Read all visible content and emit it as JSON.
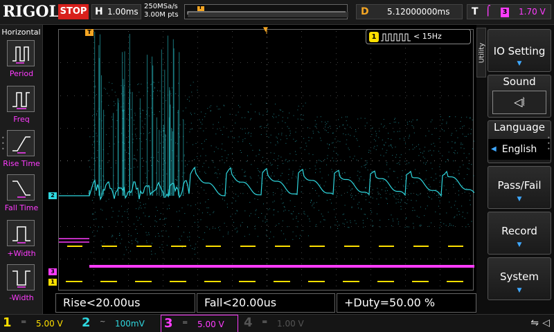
{
  "topbar": {
    "brand": "RIGOL",
    "run_state": "STOP",
    "horizontal_letter": "H",
    "timebase": "1.00ms",
    "sample_rate": "250MSa/s",
    "memory_depth": "3.00M pts",
    "trigger_marker": "T",
    "delay_letter": "D",
    "delay_value": "5.12000000ms",
    "trigger_letter": "T",
    "trigger_source": "3",
    "trigger_level": "1.70 V"
  },
  "left_panel": {
    "title": "Horizontal",
    "items": [
      {
        "label": "Period",
        "icon": "period-icon"
      },
      {
        "label": "Freq",
        "icon": "freq-icon"
      },
      {
        "label": "Rise Time",
        "icon": "rise-time-icon"
      },
      {
        "label": "Fall Time",
        "icon": "fall-time-icon"
      },
      {
        "label": "+Width",
        "icon": "positive-width-icon"
      },
      {
        "label": "-Width",
        "icon": "negative-width-icon"
      }
    ]
  },
  "frequency_counter": {
    "channel": "1",
    "value": "< 15Hz"
  },
  "channel_markers": {
    "ch1": "1",
    "ch2": "2",
    "ch3": "3",
    "trigger_level": "T",
    "trigger_position": "T"
  },
  "measurements": [
    {
      "text": "Rise<20.00us"
    },
    {
      "text": "Fall<20.00us"
    },
    {
      "text": "+Duty=50.00 %"
    }
  ],
  "channels": [
    {
      "number": "1",
      "coupling": "=",
      "scale": "5.00 V",
      "color": "#ffe000",
      "active": true
    },
    {
      "number": "2",
      "coupling": "~",
      "scale": "100mV",
      "color": "#2fd8e0",
      "active": true
    },
    {
      "number": "3",
      "coupling": "=",
      "scale": "5.00 V",
      "color": "#ff3cff",
      "active": true
    },
    {
      "number": "4",
      "coupling": "=",
      "scale": "1.00 V",
      "color": "#555555",
      "active": false
    }
  ],
  "status_icons": {
    "usb": "usb-icon",
    "speaker": "speaker-icon"
  },
  "right_menu": {
    "tab": "Utility",
    "io_setting": "IO Setting",
    "sound": "Sound",
    "language": "Language",
    "language_value": "English",
    "pass_fail": "Pass/Fail",
    "record": "Record",
    "system": "System"
  },
  "colors": {
    "ch1": "#ffe000",
    "ch2": "#2fd8e0",
    "ch3": "#ff3cff",
    "trigger": "#f5a623",
    "stop": "#d8201c",
    "menu_arrow": "#3fa8ff"
  }
}
